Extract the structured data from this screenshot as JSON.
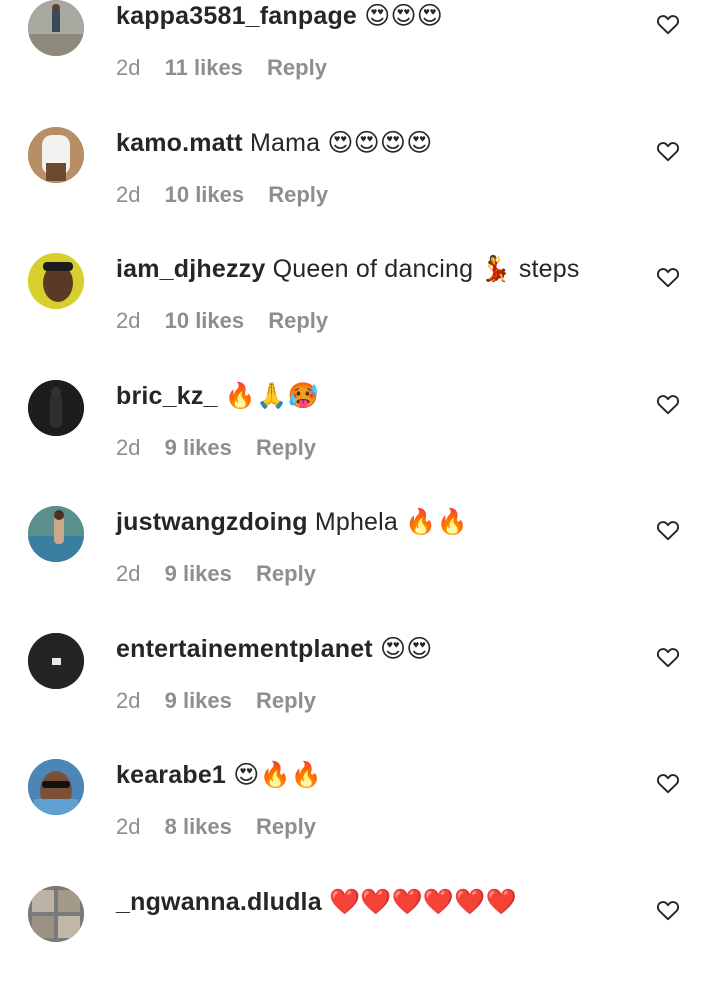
{
  "comments": [
    {
      "username": "kappa3581_fanpage",
      "text": "😍😍😍",
      "age": "2d",
      "likes": "11 likes",
      "reply": "Reply",
      "avatar": "avatar-outdoor-figure",
      "avatar_bg": "#9a9a92"
    },
    {
      "username": "kamo.matt",
      "text": "Mama 😍😍😍😍",
      "age": "2d",
      "likes": "10 likes",
      "reply": "Reply",
      "avatar": "avatar-white-outfit",
      "avatar_bg": "#b38a63"
    },
    {
      "username": "iam_djhezzy",
      "text": "Queen of dancing 💃 steps",
      "age": "2d",
      "likes": "10 likes",
      "reply": "Reply",
      "avatar": "avatar-face-yellow",
      "avatar_bg": "#d8cc2a"
    },
    {
      "username": "bric_kz_",
      "text": "🔥🙏🥵",
      "age": "2d",
      "likes": "9 likes",
      "reply": "Reply",
      "avatar": "avatar-dark-silhouette",
      "avatar_bg": "#1f1f1f"
    },
    {
      "username": "justwangzdoing",
      "text": "Mphela 🔥🔥",
      "age": "2d",
      "likes": "9 likes",
      "reply": "Reply",
      "avatar": "avatar-poolside",
      "avatar_bg": "#4c8a8a"
    },
    {
      "username": "entertainementplanet",
      "text": "😍😍",
      "age": "2d",
      "likes": "9 likes",
      "reply": "Reply",
      "avatar": "avatar-logo-dark",
      "avatar_bg": "#222222"
    },
    {
      "username": "kearabe1",
      "text": "😍🔥🔥",
      "age": "2d",
      "likes": "8 likes",
      "reply": "Reply",
      "avatar": "avatar-sunglasses",
      "avatar_bg": "#3d7fb0"
    },
    {
      "username": "_ngwanna.dludla",
      "text": "❤️❤️❤️❤️❤️❤️",
      "age": "",
      "likes": "",
      "reply": "",
      "avatar": "avatar-collage",
      "avatar_bg": "#8a8a8a"
    }
  ],
  "icons": {
    "like": "heart-outline-icon"
  }
}
